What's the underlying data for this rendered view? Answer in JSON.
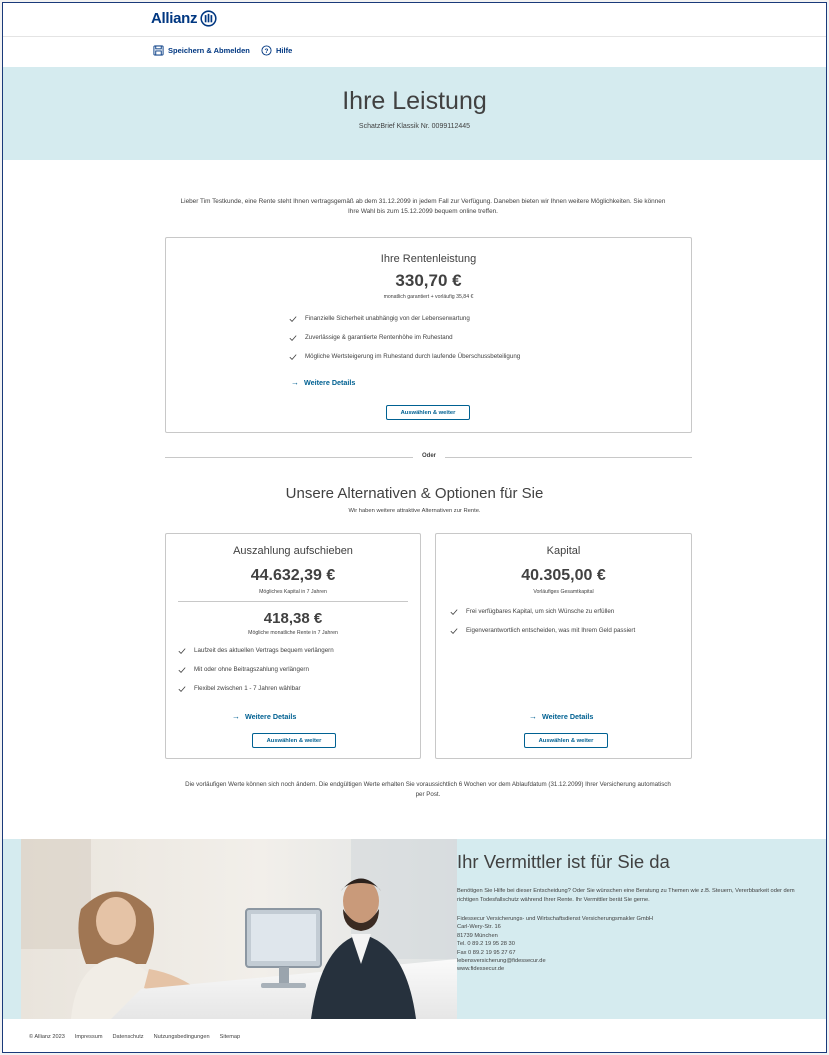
{
  "header": {
    "logo_text": "Allianz",
    "save_label": "Speichern & Abmelden",
    "help_label": "Hilfe"
  },
  "hero": {
    "title": "Ihre Leistung",
    "subtitle": "SchatzBrief Klassik Nr. 0099112445"
  },
  "intro": "Lieber Tim Testkunde, eine Rente steht Ihnen vertragsgemäß ab dem 31.12.2099 in jedem Fall zur Verfügung. Daneben bieten wir Ihnen weitere Möglichkeiten. Sie können Ihre Wahl bis zum 15.12.2099 bequem online treffen.",
  "pension": {
    "title": "Ihre Rentenleistung",
    "amount": "330,70 €",
    "note": "monatlich garantiert + vorläufig 35,84 €",
    "features": [
      "Finanzielle Sicherheit unabhängig von der Lebenserwartung",
      "Zuverlässige & garantierte Rentenhöhe im Ruhestand",
      "Mögliche Wertsteigerung im Ruhestand durch laufende Überschussbeteiligung"
    ],
    "details_link": "Weitere Details",
    "button": "Auswählen & weiter"
  },
  "separator": "Oder",
  "alternatives": {
    "title": "Unsere Alternativen & Optionen für Sie",
    "subtitle": "Wir haben weitere attraktive Alternativen zur Rente."
  },
  "defer": {
    "title": "Auszahlung aufschieben",
    "amount1": "44.632,39 €",
    "note1": "Mögliches Kapital in 7 Jahren",
    "amount2": "418,38 €",
    "note2": "Mögliche monatliche Rente in 7 Jahren",
    "features": [
      "Laufzeit des aktuellen Vertrags bequem verlängern",
      "Mit oder ohne Beitragszahlung verlängern",
      "Flexibel zwischen 1 - 7 Jahren wählbar"
    ],
    "details_link": "Weitere Details",
    "button": "Auswählen & weiter"
  },
  "capital": {
    "title": "Kapital",
    "amount": "40.305,00 €",
    "note": "Vorläufiges Gesamtkapital",
    "features": [
      "Frei verfügbares Kapital, um sich Wünsche zu erfüllen",
      "Eigenverantwortlich entscheiden, was mit Ihrem Geld passiert"
    ],
    "details_link": "Weitere Details",
    "button": "Auswählen & weiter"
  },
  "footnote": "Die vorläufigen Werte können sich noch ändern. Die endgültigen Werte erhalten Sie voraussichtlich 6 Wochen vor dem Ablaufdatum (31.12.2099) Ihrer Versicherung automatisch per Post.",
  "consultant": {
    "title": "Ihr Vermittler ist für Sie da",
    "lead": "Benötigen Sie Hilfe bei dieser Entscheidung? Oder Sie wünschen eine Beratung zu Themen wie z.B. Steuern, Vererbbarkeit oder dem richtigen Todesfallschutz während Ihrer Rente. Ihr Vermittler berät Sie gerne.",
    "company": "Fidessecur Versicherungs- und Wirtschaftsdienst Versicherungsmakler GmbH",
    "street": "Carl-Wery-Str. 16",
    "city": "81739 München",
    "phone": "Tel. 0 89.2 19 95 28 30",
    "fax": "Fax 0 89.2 19 95 27 67",
    "email": "lebensversicherung@fidessecur.de",
    "web": "www.fidessecur.de"
  },
  "footer": {
    "copyright": "© Allianz 2023",
    "links": [
      "Impressum",
      "Datenschutz",
      "Nutzungsbedingungen",
      "Sitemap"
    ]
  },
  "colors": {
    "brand": "#003781",
    "accent": "#006192",
    "hero_bg": "#d5ebef",
    "text": "#414141"
  }
}
